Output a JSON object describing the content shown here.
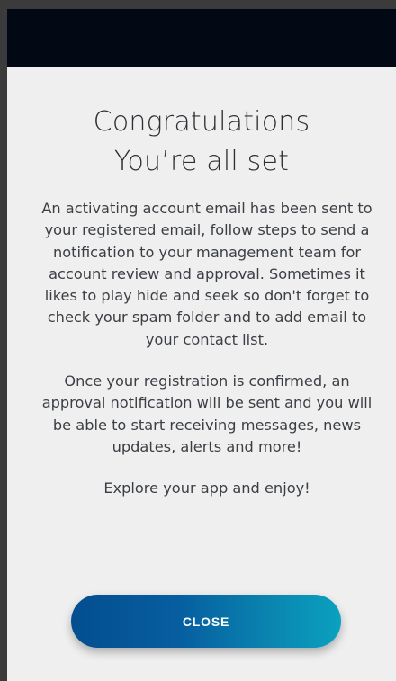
{
  "dialog": {
    "title_line1": "Congratulations",
    "title_line2": "You’re all set",
    "paragraph1": "An activating account email has been sent to your registered email, follow steps to send a notification to your management team for account review and approval. Sometimes it likes to play hide and seek so don't forget to check your spam folder and to add email to your contact list.",
    "paragraph2": "Once your registration is confirmed, an approval notification will be sent and you will be able to start receiving messages, news updates, alerts and more!",
    "paragraph3": "Explore your app and enjoy!",
    "close_label": "CLOSE"
  },
  "colors": {
    "header_bar": "#030914",
    "sheet_background": "#efefef",
    "text": "#3b3f44",
    "button_gradient_start": "#034e8f",
    "button_gradient_end": "#0aa1c0",
    "button_text": "#ffffff"
  }
}
